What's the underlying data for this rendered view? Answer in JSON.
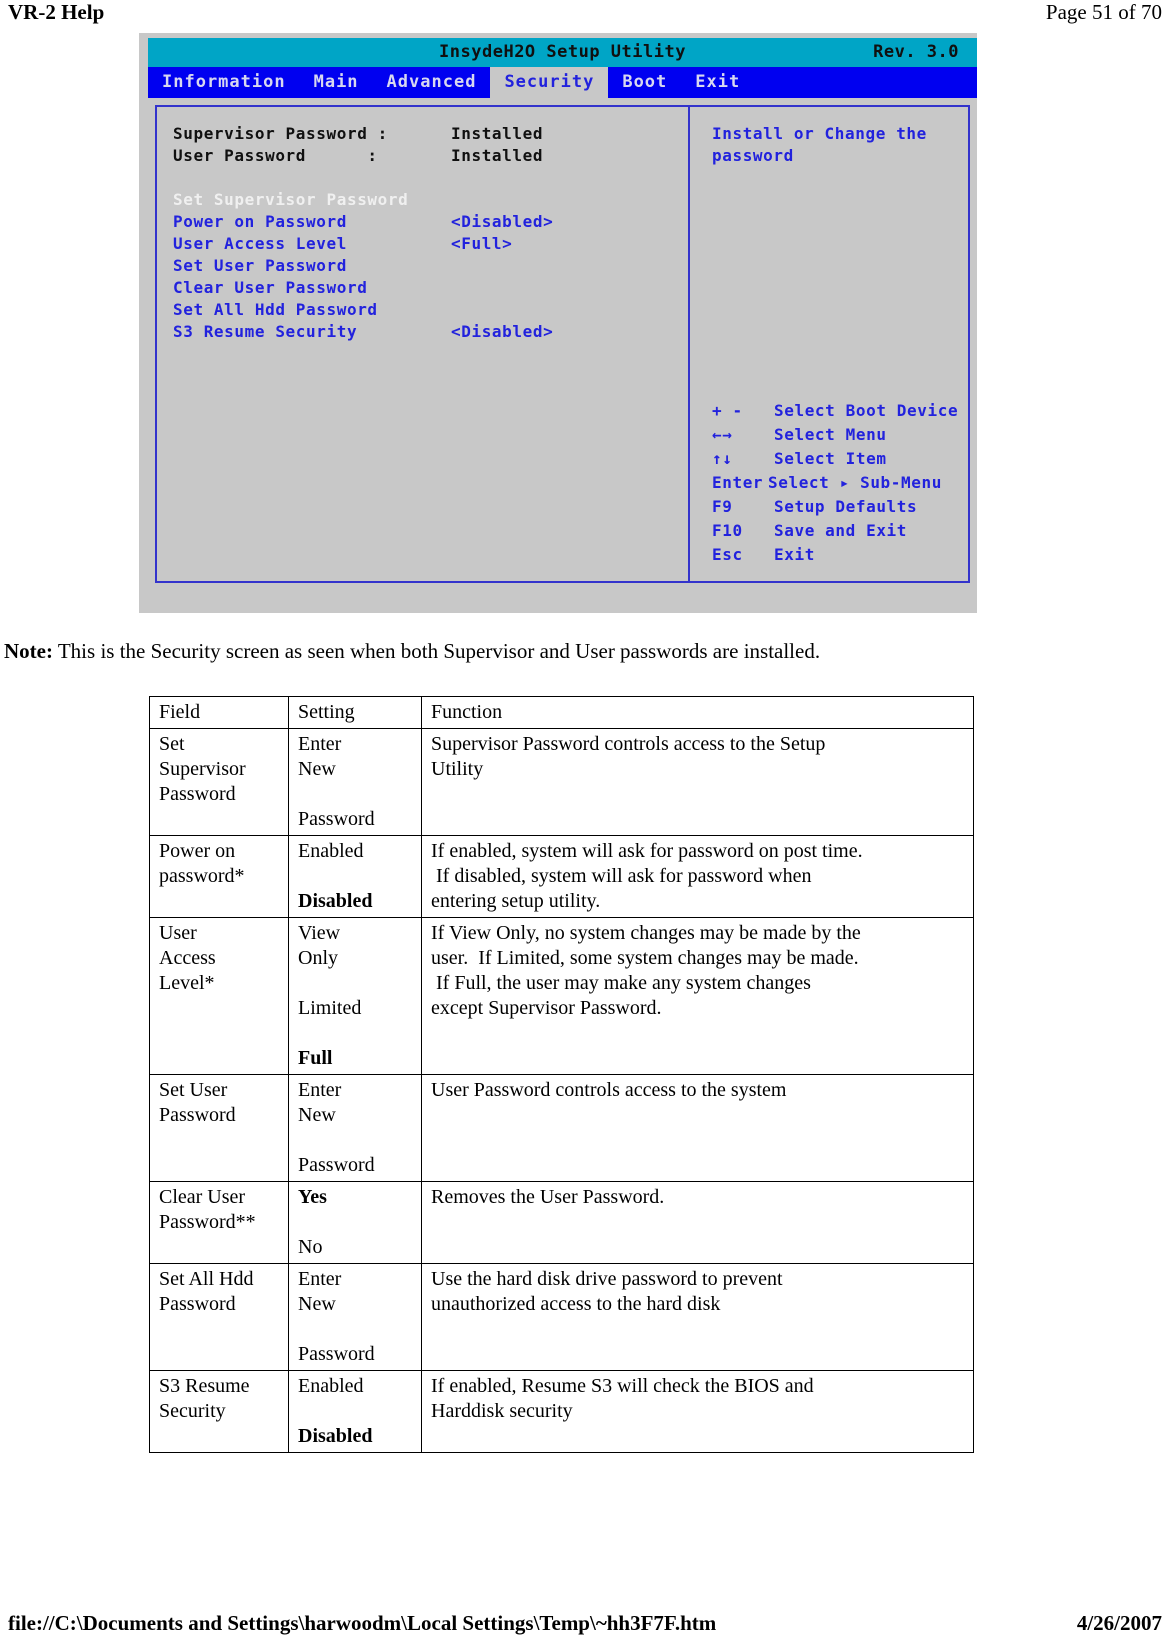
{
  "page_header": {
    "left": "VR-2 Help",
    "right": "Page 51 of 70"
  },
  "bios": {
    "title": "InsydeH2O Setup Utility",
    "revision": "Rev. 3.0",
    "menu": [
      {
        "label": "Information",
        "active": false
      },
      {
        "label": "Main",
        "active": false
      },
      {
        "label": "Advanced",
        "active": false
      },
      {
        "label": "Security",
        "active": true
      },
      {
        "label": "Boot",
        "active": false
      },
      {
        "label": "Exit",
        "active": false
      }
    ],
    "status_rows": [
      {
        "label": "Supervisor Password :",
        "value": "Installed"
      },
      {
        "label": "User Password      :",
        "value": "Installed"
      }
    ],
    "menu_items": [
      {
        "label": "Set Supervisor Password",
        "value": "",
        "style": "white"
      },
      {
        "label": "Power on Password",
        "value": "<Disabled>",
        "style": "blue"
      },
      {
        "label": "User Access Level",
        "value": "<Full>",
        "style": "blue"
      },
      {
        "label": "Set User Password",
        "value": "",
        "style": "blue"
      },
      {
        "label": "Clear User Password",
        "value": "",
        "style": "blue"
      },
      {
        "label": "Set All Hdd Password",
        "value": "",
        "style": "blue"
      },
      {
        "label": "S3 Resume Security",
        "value": "<Disabled>",
        "style": "blue"
      }
    ],
    "help_text_line1": "Install or Change the",
    "help_text_line2": "password",
    "key_legend": [
      {
        "key": "+ -",
        "desc": "Select Boot Device"
      },
      {
        "key": "←→",
        "desc": "Select Menu"
      },
      {
        "key": "↑↓",
        "desc": "Select Item"
      },
      {
        "key": "Enter",
        "desc": "Select ▸ Sub-Menu"
      },
      {
        "key": "F9",
        "desc": "Setup Defaults"
      },
      {
        "key": "F10",
        "desc": "Save and Exit"
      },
      {
        "key": "Esc",
        "desc": "Exit"
      }
    ],
    "colors": {
      "titlebar": "#00a5c6",
      "menubar": "#0000f0",
      "panel_bg": "#c8c8c8",
      "border": "#3333cc",
      "item_blue": "#2222dd"
    }
  },
  "note": {
    "label": "Note:",
    "text": " This is the Security screen as seen when both Supervisor and User passwords are installed."
  },
  "table": {
    "headers": [
      "Field",
      "Setting",
      "Function"
    ],
    "rows": [
      {
        "field": [
          "Set",
          "Supervisor",
          "Password"
        ],
        "setting": [
          {
            "text": "Enter",
            "bold": false
          },
          {
            "text": "New",
            "bold": false
          },
          {
            "text": "",
            "bold": false
          },
          {
            "text": "Password",
            "bold": false
          }
        ],
        "function": [
          "Supervisor Password controls access to the Setup",
          "Utility"
        ]
      },
      {
        "field": [
          "Power on",
          "password*"
        ],
        "setting": [
          {
            "text": "Enabled",
            "bold": false
          },
          {
            "text": "",
            "bold": false
          },
          {
            "text": "Disabled",
            "bold": true
          }
        ],
        "function": [
          "If enabled, system will ask for password on post time.",
          " If disabled, system will ask for password when",
          "entering setup utility."
        ]
      },
      {
        "field": [
          "User",
          "Access",
          "Level*"
        ],
        "setting": [
          {
            "text": "View",
            "bold": false
          },
          {
            "text": "Only",
            "bold": false
          },
          {
            "text": "",
            "bold": false
          },
          {
            "text": "Limited",
            "bold": false
          },
          {
            "text": "",
            "bold": false
          },
          {
            "text": "Full",
            "bold": true
          }
        ],
        "function": [
          "If View Only, no system changes may be made by the",
          "user.  If Limited, some system changes may be made.",
          " If Full, the user may make any system changes",
          "except Supervisor Password."
        ]
      },
      {
        "field": [
          "Set User",
          "Password"
        ],
        "setting": [
          {
            "text": "Enter",
            "bold": false
          },
          {
            "text": "New",
            "bold": false
          },
          {
            "text": "",
            "bold": false
          },
          {
            "text": "Password",
            "bold": false
          }
        ],
        "function": [
          "User Password controls access to the system"
        ]
      },
      {
        "field": [
          "Clear User",
          "Password**"
        ],
        "setting": [
          {
            "text": "Yes",
            "bold": true
          },
          {
            "text": "",
            "bold": false
          },
          {
            "text": "No",
            "bold": false
          }
        ],
        "function": [
          "Removes the User Password."
        ]
      },
      {
        "field": [
          "Set All Hdd",
          "Password"
        ],
        "setting": [
          {
            "text": "Enter",
            "bold": false
          },
          {
            "text": "New",
            "bold": false
          },
          {
            "text": "",
            "bold": false
          },
          {
            "text": "Password",
            "bold": false
          }
        ],
        "function": [
          "Use the hard disk drive password to prevent",
          "unauthorized access to the hard disk"
        ]
      },
      {
        "field": [
          "S3 Resume",
          "Security"
        ],
        "setting": [
          {
            "text": "Enabled",
            "bold": false
          },
          {
            "text": "",
            "bold": false
          },
          {
            "text": "Disabled",
            "bold": true
          }
        ],
        "function": [
          "If enabled, Resume S3 will check the BIOS and",
          "Harddisk security"
        ]
      }
    ]
  },
  "page_footer": {
    "left": "file://C:\\Documents and Settings\\harwoodm\\Local Settings\\Temp\\~hh3F7F.htm",
    "right": "4/26/2007"
  }
}
